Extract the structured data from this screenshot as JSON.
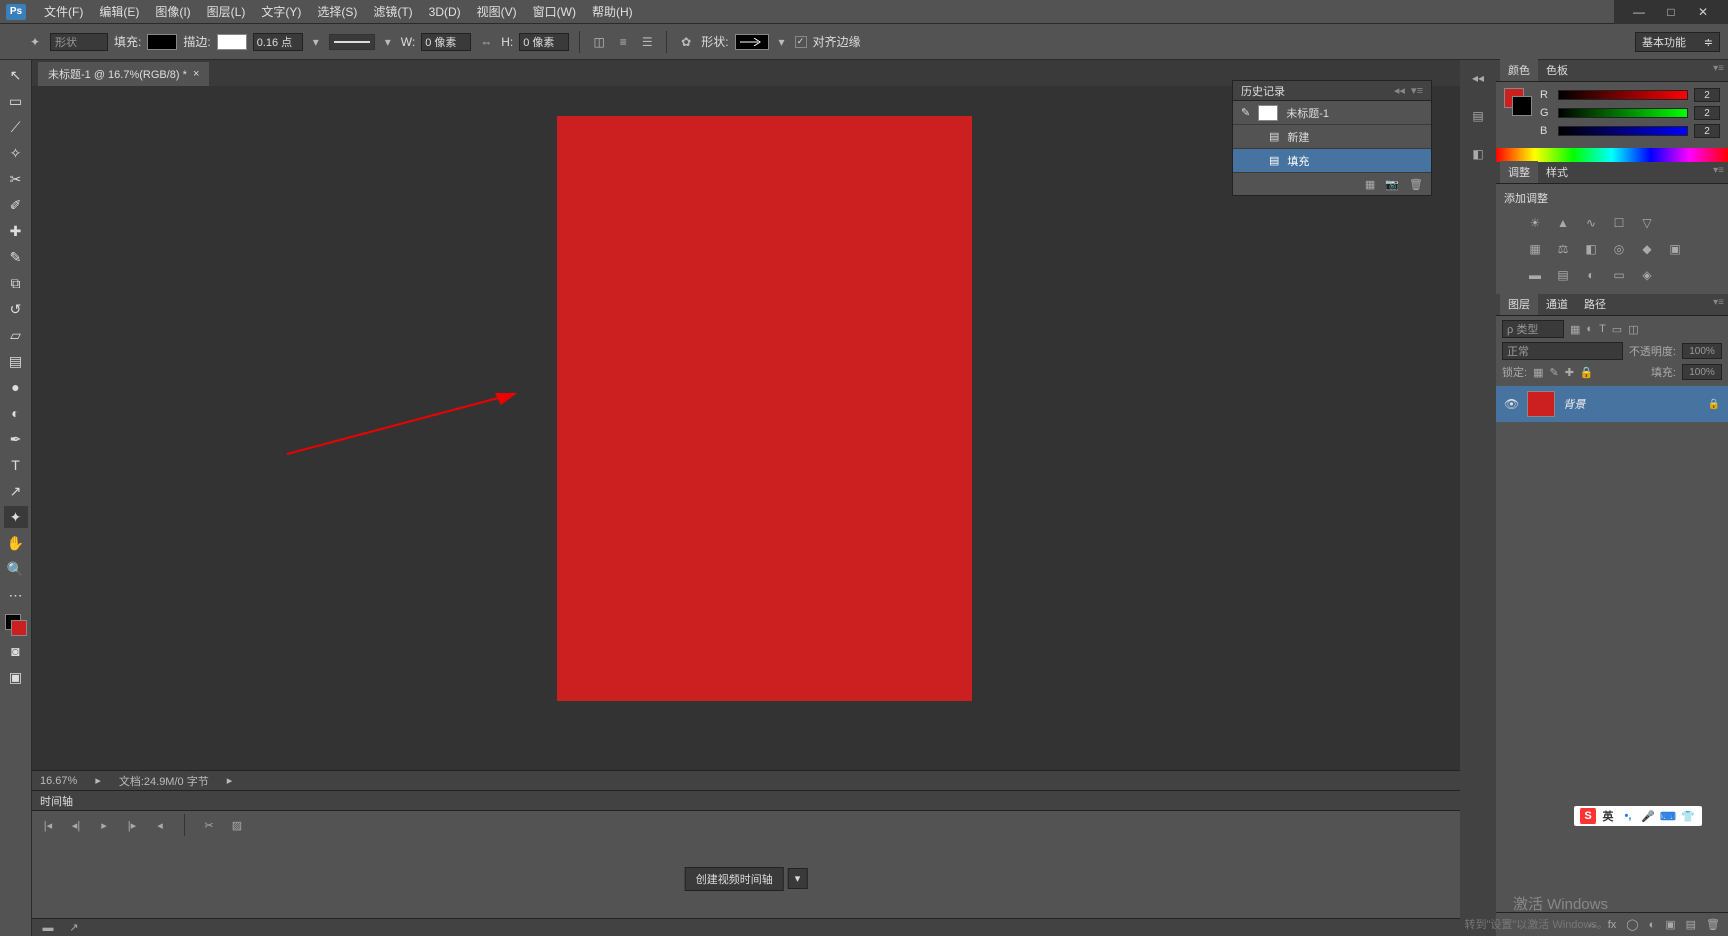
{
  "menu": {
    "items": [
      "文件(F)",
      "编辑(E)",
      "图像(I)",
      "图层(L)",
      "文字(Y)",
      "选择(S)",
      "滤镜(T)",
      "3D(D)",
      "视图(V)",
      "窗口(W)",
      "帮助(H)"
    ]
  },
  "options": {
    "shape_mode": "形状",
    "fill_label": "填充:",
    "stroke_label": "描边:",
    "stroke_val": "0.16 点",
    "w_label": "W:",
    "w_val": "0 像素",
    "h_label": "H:",
    "h_val": "0 像素",
    "shape_label": "形状:",
    "align_label": "对齐边缘",
    "workspace": "基本功能"
  },
  "doc": {
    "tab_title": "未标题-1 @ 16.7%(RGB/8) *",
    "zoom": "16.67%",
    "doc_info": "文档:24.9M/0 字节"
  },
  "timeline": {
    "tab": "时间轴",
    "create_btn": "创建视频时间轴"
  },
  "history": {
    "title": "历史记录",
    "doc_name": "未标题-1",
    "items": [
      {
        "label": "新建"
      },
      {
        "label": "填充"
      }
    ]
  },
  "panels": {
    "color_tab": "颜色",
    "swatches_tab": "色板",
    "r": "R",
    "g": "G",
    "b": "B",
    "r_val": "2",
    "g_val": "2",
    "b_val": "2",
    "adjust_tab": "调整",
    "styles_tab": "样式",
    "add_adjust": "添加调整",
    "layers_tab": "图层",
    "channels_tab": "通道",
    "paths_tab": "路径",
    "kind_label": "ρ 类型",
    "blend": "正常",
    "opacity_label": "不透明度:",
    "opacity_val": "100%",
    "lock_label": "锁定:",
    "fill_label": "填充:",
    "fill_val": "100%",
    "bg_layer": "背景"
  },
  "watermark": {
    "line1": "激活 Windows",
    "line2": "转到\"设置\"以激活 Windows。"
  },
  "ime": {
    "lang": "英"
  }
}
